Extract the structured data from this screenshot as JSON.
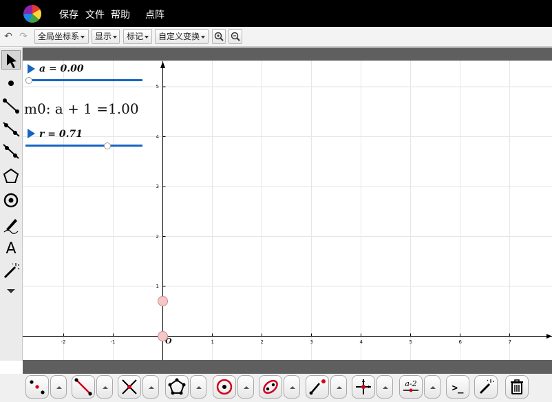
{
  "menu": {
    "save": "保存",
    "file": "文件",
    "help": "帮助",
    "dotmatrix": "点阵"
  },
  "toolbar": {
    "coord_system": "全局坐标系",
    "display": "显示",
    "mark": "标记",
    "custom_transform": "自定义变换"
  },
  "sliders": {
    "a_label": "a = 0.00",
    "r_label": "r = 0.71",
    "a_value": 0.0,
    "r_value": 0.71
  },
  "measurement": "m0: a + 1 =1.00",
  "axes": {
    "x_ticks": [
      "-2",
      "-1",
      "1",
      "2",
      "3",
      "4",
      "5",
      "6",
      "7"
    ],
    "y_ticks": [
      "5",
      "4",
      "3",
      "2",
      "1"
    ],
    "origin_label": "O"
  },
  "points": [
    {
      "x": 0,
      "y": 0.71
    },
    {
      "x": 0,
      "y": 0
    }
  ],
  "colors": {
    "accent": "#1565c0",
    "menubar": "#000000",
    "point_fill": "#f5c7c7"
  },
  "icons": {
    "left_tools": [
      "arrow-select-icon",
      "point-icon",
      "segment-icon",
      "ray-icon",
      "line-icon",
      "polygon-icon",
      "circle-icon",
      "pen-icon",
      "text-icon",
      "magic-wand-icon",
      "more-icon"
    ],
    "bottom_tools": [
      "points-tool-icon",
      "line-tool-icon",
      "intersect-tool-icon",
      "polygon-tool-icon",
      "circle-tool-icon",
      "conic-tool-icon",
      "segment-end-tool-icon",
      "axis-tool-icon",
      "function-tool-icon",
      "command-tool-icon",
      "magic-tool-icon",
      "trash-icon"
    ]
  },
  "bottom_tools": {
    "function_label": "a-2",
    "command_label": ">_"
  }
}
